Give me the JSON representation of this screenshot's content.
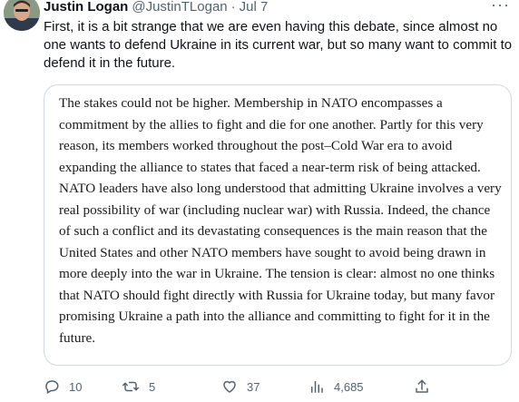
{
  "tweet": {
    "author_name": "Justin Logan",
    "handle": "@JustinTLogan",
    "separator": "·",
    "date": "Jul 7",
    "more_label": "···",
    "text": "First, it is a bit strange that we are even having this debate, since almost no one wants to defend Ukraine in its current war, but so many want to commit to defend it in the future."
  },
  "quote": {
    "text": "The stakes could not be higher. Membership in NATO encompasses a commitment by the allies to fight and die for one another. Partly for this very reason, its members worked throughout the post–Cold War era to avoid expanding the alliance to states that faced a near-term risk of being attacked. NATO leaders have also long understood that admitting Ukraine involves a very real possibility of war (including nuclear war) with Russia. Indeed, the chance of such a conflict and its devastating consequences is the main reason that the United States and other NATO members have sought to avoid being drawn in more deeply into the war in Ukraine. The tension is clear: almost no one thinks that NATO should fight directly with Russia for Ukraine today, but many favor promising Ukraine a path into the alliance and committing to fight for it in the future."
  },
  "actions": {
    "replies": "10",
    "retweets": "5",
    "likes": "37",
    "views": "4,685",
    "icons": [
      "reply-icon",
      "retweet-icon",
      "like-icon",
      "views-icon",
      "share-icon"
    ]
  },
  "colors": {
    "text_primary": "#0f1419",
    "text_secondary": "#536471",
    "border": "#cfd9de"
  }
}
